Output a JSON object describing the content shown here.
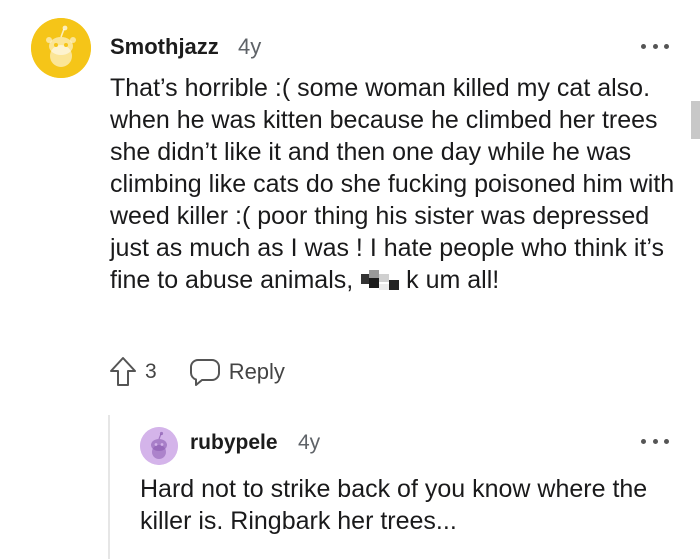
{
  "comment": {
    "author": "Smothjazz",
    "age": "4y",
    "avatar_color": "#f5c518",
    "text_before": "That’s horrible :( some woman killed my cat also. when he was kitten because he climbed her trees she didn’t like it and then one day while he was climbing like cats do she fucking poisoned him with weed killer :( poor thing his sister was depressed just as much as I was ! I hate people who think it’s fine to abuse animals,",
    "text_after": "k um all!",
    "vote_count": "3",
    "reply_label": "Reply",
    "icons": {
      "more": "more-options-icon",
      "upvote": "upvote-arrow-icon",
      "reply": "speech-bubble-icon",
      "censor": "pixelated-censor-icon"
    }
  },
  "reply": {
    "author": "rubypele",
    "age": "4y",
    "avatar_color": "#d4b4ea",
    "text": "Hard not to strike back of you know where the killer is. Ringbark her trees..."
  }
}
